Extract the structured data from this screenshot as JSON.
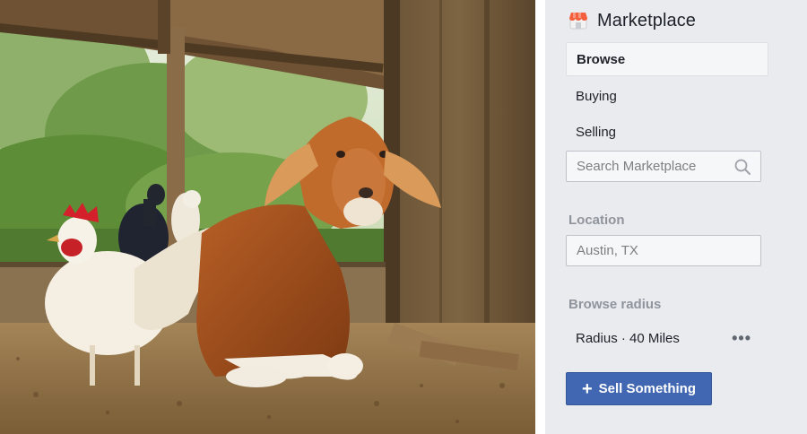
{
  "colors": {
    "sidebar_bg": "#e9ebee",
    "accent": "#4267b2",
    "secondary_text": "#90949c"
  },
  "photo": {
    "subject": "goat and chickens in a barn"
  },
  "sidebar": {
    "title": "Marketplace",
    "title_icon": "storefront-icon",
    "nav": [
      {
        "label": "Browse",
        "active": true
      },
      {
        "label": "Buying",
        "active": false
      },
      {
        "label": "Selling",
        "active": false
      }
    ],
    "search": {
      "placeholder": "Search Marketplace",
      "value": "",
      "icon": "search-icon"
    },
    "location": {
      "label": "Location",
      "value": "Austin, TX"
    },
    "radius": {
      "label": "Browse radius",
      "text": "Radius · 40 Miles",
      "more_icon": "more-dots-icon"
    },
    "sell_button": {
      "label": "Sell Something",
      "icon": "plus-icon"
    }
  }
}
